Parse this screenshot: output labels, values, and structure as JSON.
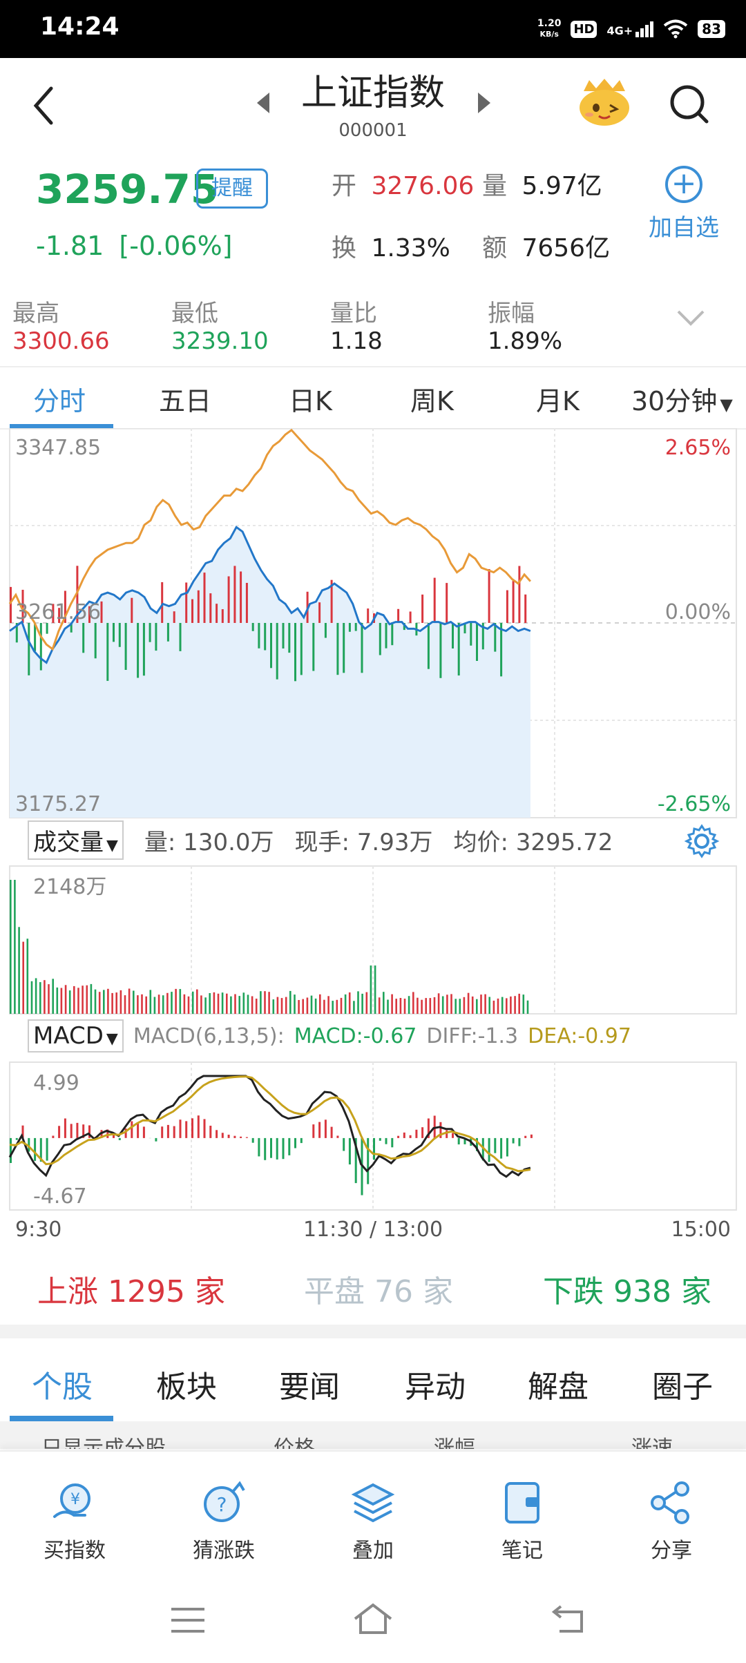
{
  "status_bar": {
    "time": "14:24",
    "net_speed": "1.20",
    "net_unit": "KB/s",
    "hd": "HD",
    "signal": "4G+",
    "battery": "83"
  },
  "header": {
    "title": "上证指数",
    "code": "000001"
  },
  "quote": {
    "price": "3259.75",
    "remind_label": "提醒",
    "change": "-1.81",
    "change_pct": "[-0.06%]",
    "open_label": "开",
    "open": "3276.06",
    "volume_label": "量",
    "volume": "5.97亿",
    "turnover_label": "换",
    "turnover": "1.33%",
    "amount_label": "额",
    "amount": "7656亿",
    "add_label": "加自选"
  },
  "stats": [
    {
      "label": "最高",
      "value": "3300.66",
      "color": "#d9363e"
    },
    {
      "label": "最低",
      "value": "3239.10",
      "color": "#1fa35a"
    },
    {
      "label": "量比",
      "value": "1.18",
      "color": "#222222"
    },
    {
      "label": "振幅",
      "value": "1.89%",
      "color": "#222222"
    }
  ],
  "tabs": [
    "分时",
    "五日",
    "日K",
    "周K",
    "月K",
    "30分钟"
  ],
  "chart_data": {
    "type": "line",
    "price_axis": {
      "max": "3347.85",
      "mid": "3261.56",
      "min": "3175.27",
      "max_pct": "2.65%",
      "mid_pct": "0.00%",
      "min_pct": "-2.65%"
    },
    "price_ylim": [
      3175.27,
      3347.85
    ],
    "prev_close": 3261.56,
    "x_ticks": [
      "9:30",
      "11:30 / 13:00",
      "15:00"
    ],
    "volume_panel": {
      "selector": "成交量",
      "info": [
        "量: 130.0万",
        "现手: 7.93万",
        "均价: 3295.72"
      ],
      "max_label": "2148万"
    },
    "macd_panel": {
      "selector": "MACD",
      "params": "MACD(6,13,5):",
      "macd": "MACD:-0.67",
      "diff": "DIFF:-1.3",
      "dea": "DEA:-0.97",
      "max_label": "4.99",
      "min_label": "-4.67",
      "ylim": [
        -4.67,
        4.99
      ]
    },
    "price_series": [
      3270,
      3274,
      3268,
      3266,
      3262,
      3256,
      3252,
      3250,
      3258,
      3264,
      3270,
      3275,
      3281,
      3286,
      3290,
      3292,
      3294,
      3295,
      3296,
      3297,
      3297,
      3299,
      3305,
      3307,
      3313,
      3316,
      3314,
      3309,
      3305,
      3306,
      3303,
      3304,
      3309,
      3312,
      3315,
      3318,
      3318,
      3321,
      3320,
      3323,
      3327,
      3330,
      3336,
      3340,
      3342,
      3345,
      3347,
      3344,
      3341,
      3338,
      3336,
      3334,
      3331,
      3328,
      3324,
      3321,
      3320,
      3316,
      3313,
      3310,
      3311,
      3309,
      3306,
      3305,
      3307,
      3308,
      3306,
      3305,
      3303,
      3300,
      3298,
      3294,
      3288,
      3284,
      3286,
      3292,
      3290,
      3286,
      3285,
      3284,
      3286,
      3284,
      3281,
      3279,
      3283,
      3280
    ],
    "avg_series": [
      3258,
      3260,
      3262,
      3254,
      3249,
      3246,
      3244,
      3250,
      3254,
      3259,
      3261,
      3265,
      3268,
      3271,
      3270,
      3274,
      3275,
      3274,
      3272,
      3275,
      3276,
      3275,
      3273,
      3268,
      3266,
      3270,
      3269,
      3270,
      3274,
      3275,
      3280,
      3284,
      3288,
      3289,
      3294,
      3297,
      3299,
      3304,
      3302,
      3296,
      3290,
      3285,
      3281,
      3278,
      3272,
      3270,
      3266,
      3268,
      3264,
      3270,
      3271,
      3276,
      3277,
      3279,
      3277,
      3275,
      3270,
      3262,
      3259,
      3261,
      3266,
      3265,
      3261,
      3262,
      3262,
      3259,
      3259,
      3258,
      3260,
      3262,
      3262,
      3261,
      3262,
      3260,
      3261,
      3262,
      3262,
      3260,
      3259,
      3261,
      3259,
      3258,
      3260,
      3258,
      3259,
      3258
    ]
  },
  "breadth": {
    "up_label": "上涨",
    "up": "1295",
    "flat_label": "平盘",
    "flat": "76",
    "down_label": "下跌",
    "down": "938",
    "unit": "家"
  },
  "bottom_tabs": [
    "个股",
    "板块",
    "要闻",
    "异动",
    "解盘",
    "圈子"
  ],
  "list_head": [
    "只显示成分股",
    "价格",
    "涨幅",
    "涨速"
  ],
  "bottom_bar": [
    {
      "label": "买指数",
      "icon": "buy-index-icon"
    },
    {
      "label": "猜涨跌",
      "icon": "guess-icon"
    },
    {
      "label": "叠加",
      "icon": "layers-icon"
    },
    {
      "label": "笔记",
      "icon": "note-icon"
    },
    {
      "label": "分享",
      "icon": "share-icon"
    }
  ],
  "colors": {
    "up": "#d9363e",
    "down": "#1fa35a",
    "accent": "#3a8fd6",
    "price_line": "#e89a38",
    "avg_line": "#2277c9"
  }
}
